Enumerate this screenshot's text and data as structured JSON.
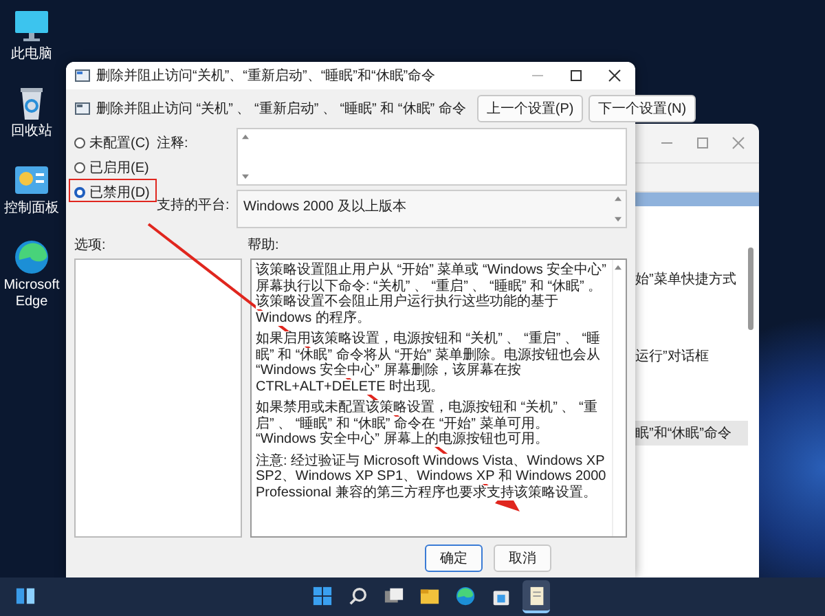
{
  "desktop_icons": [
    {
      "kind": "computer",
      "label": "此电脑"
    },
    {
      "kind": "recycle-bin",
      "label": "回收站"
    },
    {
      "kind": "control-panel",
      "label": "控制面板"
    },
    {
      "kind": "edge",
      "label": "Microsoft Edge"
    }
  ],
  "background_window": {
    "rows": [
      {
        "text": "始”菜单快捷方式",
        "selected": false
      },
      {
        "text": "运行”对话框",
        "selected": false
      },
      {
        "text": "眠”和“休眠”命令",
        "selected": true
      }
    ]
  },
  "dialog": {
    "title": "删除并阻止访问“关机”、“重新启动”、“睡眠”和“休眠”命令",
    "policy_title": "删除并阻止访问 “关机” 、 “重新启动” 、 “睡眠” 和 “休眠” 命令",
    "nav_buttons": [
      "上一个设置(P)",
      "下一个设置(N)"
    ],
    "state_options": [
      {
        "label": "未配置(C)",
        "selected": false
      },
      {
        "label": "已启用(E)",
        "selected": false
      },
      {
        "label": "已禁用(D)",
        "selected": true
      }
    ],
    "comment_label": "注释:",
    "platform_label": "支持的平台:",
    "platform_value": "Windows 2000 及以上版本",
    "options_label": "选项:",
    "help_label": "帮助:",
    "help_paragraphs": [
      "该策略设置阻止用户从 “开始” 菜单或 “Windows 安全中心” 屏幕执行以下命令: “关机” 、 “重启” 、 “睡眠” 和 “休眠” 。该策略设置不会阻止用户运行执行这些功能的基于 Windows 的程序。",
      "如果启用该策略设置，电源按钮和 “关机” 、 “重启” 、 “睡眠” 和 “休眠” 命令将从 “开始” 菜单删除。电源按钮也会从 “Windows 安全中心” 屏幕删除，该屏幕在按 CTRL+ALT+DELETE 时出现。",
      "如果禁用或未配置该策略设置，电源按钮和 “关机” 、 “重启” 、 “睡眠” 和 “休眠” 命令在 “开始” 菜单可用。 “Windows 安全中心” 屏幕上的电源按钮也可用。",
      "注意: 经过验证与 Microsoft Windows Vista、Windows XP SP2、Windows XP SP1、Windows XP 和 Windows 2000 Professional 兼容的第三方程序也要求支持该策略设置。"
    ],
    "buttons": [
      "确定",
      "取消"
    ]
  },
  "taskbar": {
    "icons": [
      {
        "kind": "widgets",
        "active": false
      },
      {
        "kind": "start",
        "active": false
      },
      {
        "kind": "search",
        "active": false
      },
      {
        "kind": "task-view",
        "active": false
      },
      {
        "kind": "file-explorer",
        "active": false
      },
      {
        "kind": "edge",
        "active": false
      },
      {
        "kind": "store",
        "active": false
      },
      {
        "kind": "notepad",
        "active": true
      }
    ]
  }
}
